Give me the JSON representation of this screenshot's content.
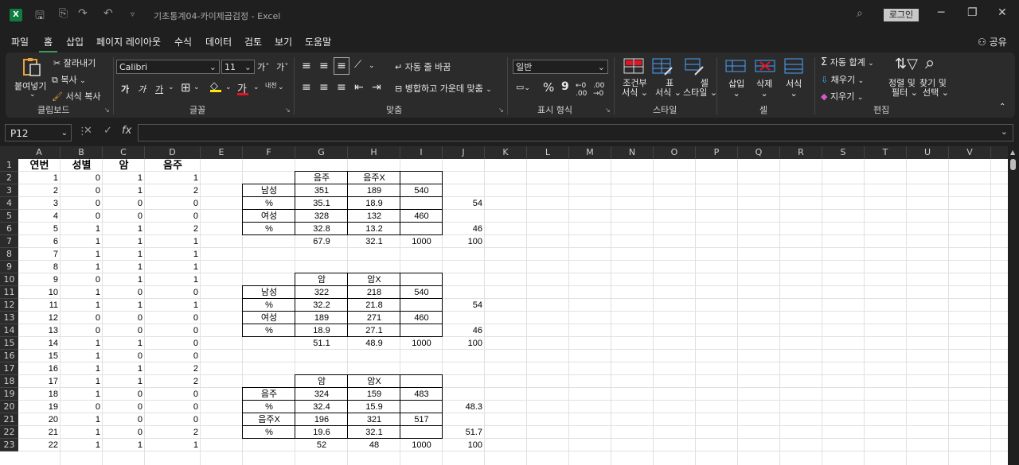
{
  "window": {
    "title": "기초통계04-카이제곱검정",
    "app": "Excel",
    "login_label": "로그인",
    "minimize": "─",
    "restore": "❐",
    "close": "✕"
  },
  "menu": {
    "items": [
      "파일",
      "홈",
      "삽입",
      "페이지 레이아웃",
      "수식",
      "데이터",
      "검토",
      "보기",
      "도움말"
    ],
    "active": "홈",
    "share": "공유"
  },
  "ribbon": {
    "clipboard": {
      "paste": "붙여넣기",
      "cut": "잘라내기",
      "copy": "복사",
      "format_painter": "서식 복사",
      "group": "클립보드"
    },
    "font": {
      "name": "Calibri",
      "size": "11",
      "bold": "가",
      "italic": "가",
      "underline": "가",
      "group": "글꼴",
      "phonetic": "내천"
    },
    "alignment": {
      "wrap": "자동 줄 바꿈",
      "merge": "병합하고 가운데 맞춤",
      "group": "맞춤"
    },
    "number": {
      "format": "일반",
      "percent": "%",
      "comma": "9",
      "group": "표시 형식"
    },
    "styles": {
      "conditional_line1": "조건부",
      "conditional_line2": "서식",
      "table_line1": "표",
      "table_line2": "서식",
      "cell_line1": "셀",
      "cell_line2": "스타일",
      "group": "스타일"
    },
    "cells": {
      "insert": "삽입",
      "delete": "삭제",
      "format": "서식",
      "group": "셀"
    },
    "editing": {
      "autosum": "자동 합계",
      "fill": "채우기",
      "clear": "지우기",
      "sort_line1": "정렬 및",
      "sort_line2": "필터",
      "find_line1": "찾기 및",
      "find_line2": "선택",
      "group": "편집"
    }
  },
  "formula_bar": {
    "name_box": "P12",
    "fx": "fx",
    "value": ""
  },
  "columns": [
    "A",
    "B",
    "C",
    "D",
    "E",
    "F",
    "G",
    "H",
    "I",
    "J",
    "K",
    "L",
    "M",
    "N",
    "O",
    "P",
    "Q",
    "R",
    "S",
    "T",
    "U",
    "V"
  ],
  "rows": [
    "1",
    "2",
    "3",
    "4",
    "5",
    "6",
    "7",
    "8",
    "9",
    "10",
    "11",
    "12",
    "13",
    "14",
    "15",
    "16",
    "17",
    "18",
    "19",
    "20",
    "21",
    "22",
    "23"
  ],
  "cells": {
    "A1": "연번",
    "B1": "성별",
    "C1": "암",
    "D1": "음주",
    "A2": "1",
    "B2": "0",
    "C2": "1",
    "D2": "1",
    "A3": "2",
    "B3": "0",
    "C3": "1",
    "D3": "2",
    "A4": "3",
    "B4": "0",
    "C4": "0",
    "D4": "0",
    "A5": "4",
    "B5": "0",
    "C5": "0",
    "D5": "0",
    "A6": "5",
    "B6": "1",
    "C6": "1",
    "D6": "2",
    "A7": "6",
    "B7": "1",
    "C7": "1",
    "D7": "1",
    "A8": "7",
    "B8": "1",
    "C8": "1",
    "D8": "1",
    "A9": "8",
    "B9": "1",
    "C9": "1",
    "D9": "1",
    "A10": "9",
    "B10": "0",
    "C10": "1",
    "D10": "1",
    "A11": "10",
    "B11": "1",
    "C11": "0",
    "D11": "0",
    "A12": "11",
    "B12": "1",
    "C12": "1",
    "D12": "1",
    "A13": "12",
    "B13": "0",
    "C13": "0",
    "D13": "0",
    "A14": "13",
    "B14": "0",
    "C14": "0",
    "D14": "0",
    "A15": "14",
    "B15": "1",
    "C15": "1",
    "D15": "0",
    "A16": "15",
    "B16": "1",
    "C16": "0",
    "D16": "0",
    "A17": "16",
    "B17": "1",
    "C17": "1",
    "D17": "2",
    "A18": "17",
    "B18": "1",
    "C18": "1",
    "D18": "2",
    "A19": "18",
    "B19": "1",
    "C19": "0",
    "D19": "0",
    "A20": "19",
    "B20": "0",
    "C20": "0",
    "D20": "0",
    "A21": "20",
    "B21": "1",
    "C21": "0",
    "D21": "0",
    "A22": "21",
    "B22": "1",
    "C22": "0",
    "D22": "2",
    "A23": "22",
    "B23": "1",
    "C23": "1",
    "D23": "1",
    "G2": "음주",
    "H2": "음주X",
    "F3": "남성",
    "G3": "351",
    "H3": "189",
    "I3": "540",
    "F4": "%",
    "G4": "35.1",
    "H4": "18.9",
    "J4": "54",
    "F5": "여성",
    "G5": "328",
    "H5": "132",
    "I5": "460",
    "F6": "%",
    "G6": "32.8",
    "H6": "13.2",
    "J6": "46",
    "G7": "67.9",
    "H7": "32.1",
    "I7": "1000",
    "J7": "100",
    "G10": "암",
    "H10": "암X",
    "F11": "남성",
    "G11": "322",
    "H11": "218",
    "I11": "540",
    "F12": "%",
    "G12": "32.2",
    "H12": "21.8",
    "J12": "54",
    "F13": "여성",
    "G13": "189",
    "H13": "271",
    "I13": "460",
    "F14": "%",
    "G14": "18.9",
    "H14": "27.1",
    "J14": "46",
    "G15": "51.1",
    "H15": "48.9",
    "I15": "1000",
    "J15": "100",
    "G18": "암",
    "H18": "암X",
    "F19": "음주",
    "G19": "324",
    "H19": "159",
    "I19": "483",
    "F20": "%",
    "G20": "32.4",
    "H20": "15.9",
    "J20": "48.3",
    "F21": "음주X",
    "G21": "196",
    "H21": "321",
    "I21": "517",
    "F22": "%",
    "G22": "19.6",
    "H22": "32.1",
    "J22": "51.7",
    "G23": "52",
    "H23": "48",
    "I23": "1000",
    "J23": "100"
  }
}
